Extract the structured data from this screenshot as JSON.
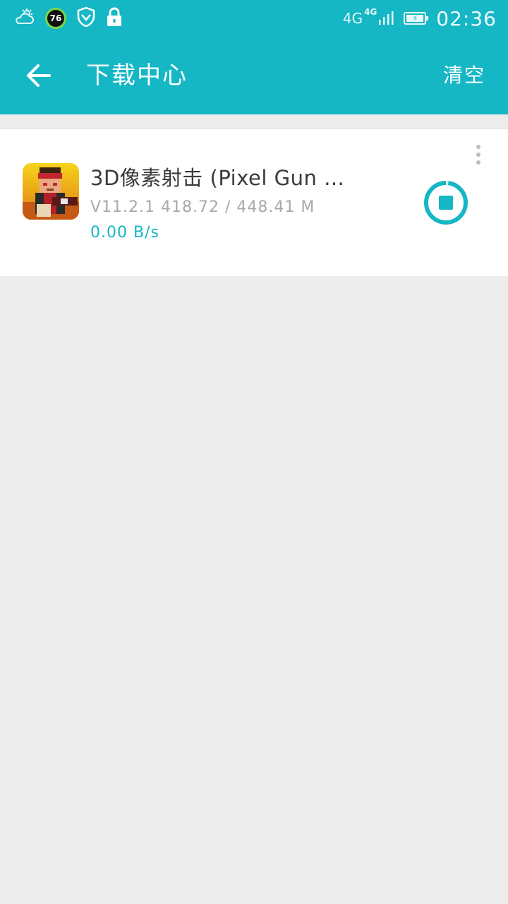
{
  "status_bar": {
    "icons": [
      "weather-cloud-icon",
      "badge-76-icon",
      "shield-icon",
      "lock-icon",
      "signal-icon",
      "battery-charging-icon"
    ],
    "badge_value": "76",
    "network_1": "4G",
    "network_2": "4G",
    "time": "02:36"
  },
  "app_bar": {
    "title": "下载中心",
    "clear_label": "清空",
    "back_icon": "arrow-left-icon"
  },
  "downloads": [
    {
      "name": "3D像素射击 (Pixel Gun …",
      "version": "V11.2.1",
      "progress": "418.72 / 448.41 M",
      "speed": "0.00 B/s",
      "status_icon": "stop-icon",
      "menu_icon": "more-vertical-icon"
    }
  ],
  "colors": {
    "accent": "#15b7c5",
    "background": "#ededed",
    "card": "#ffffff",
    "title_text": "#3a3a3a",
    "meta_text": "#a8a8a8"
  }
}
